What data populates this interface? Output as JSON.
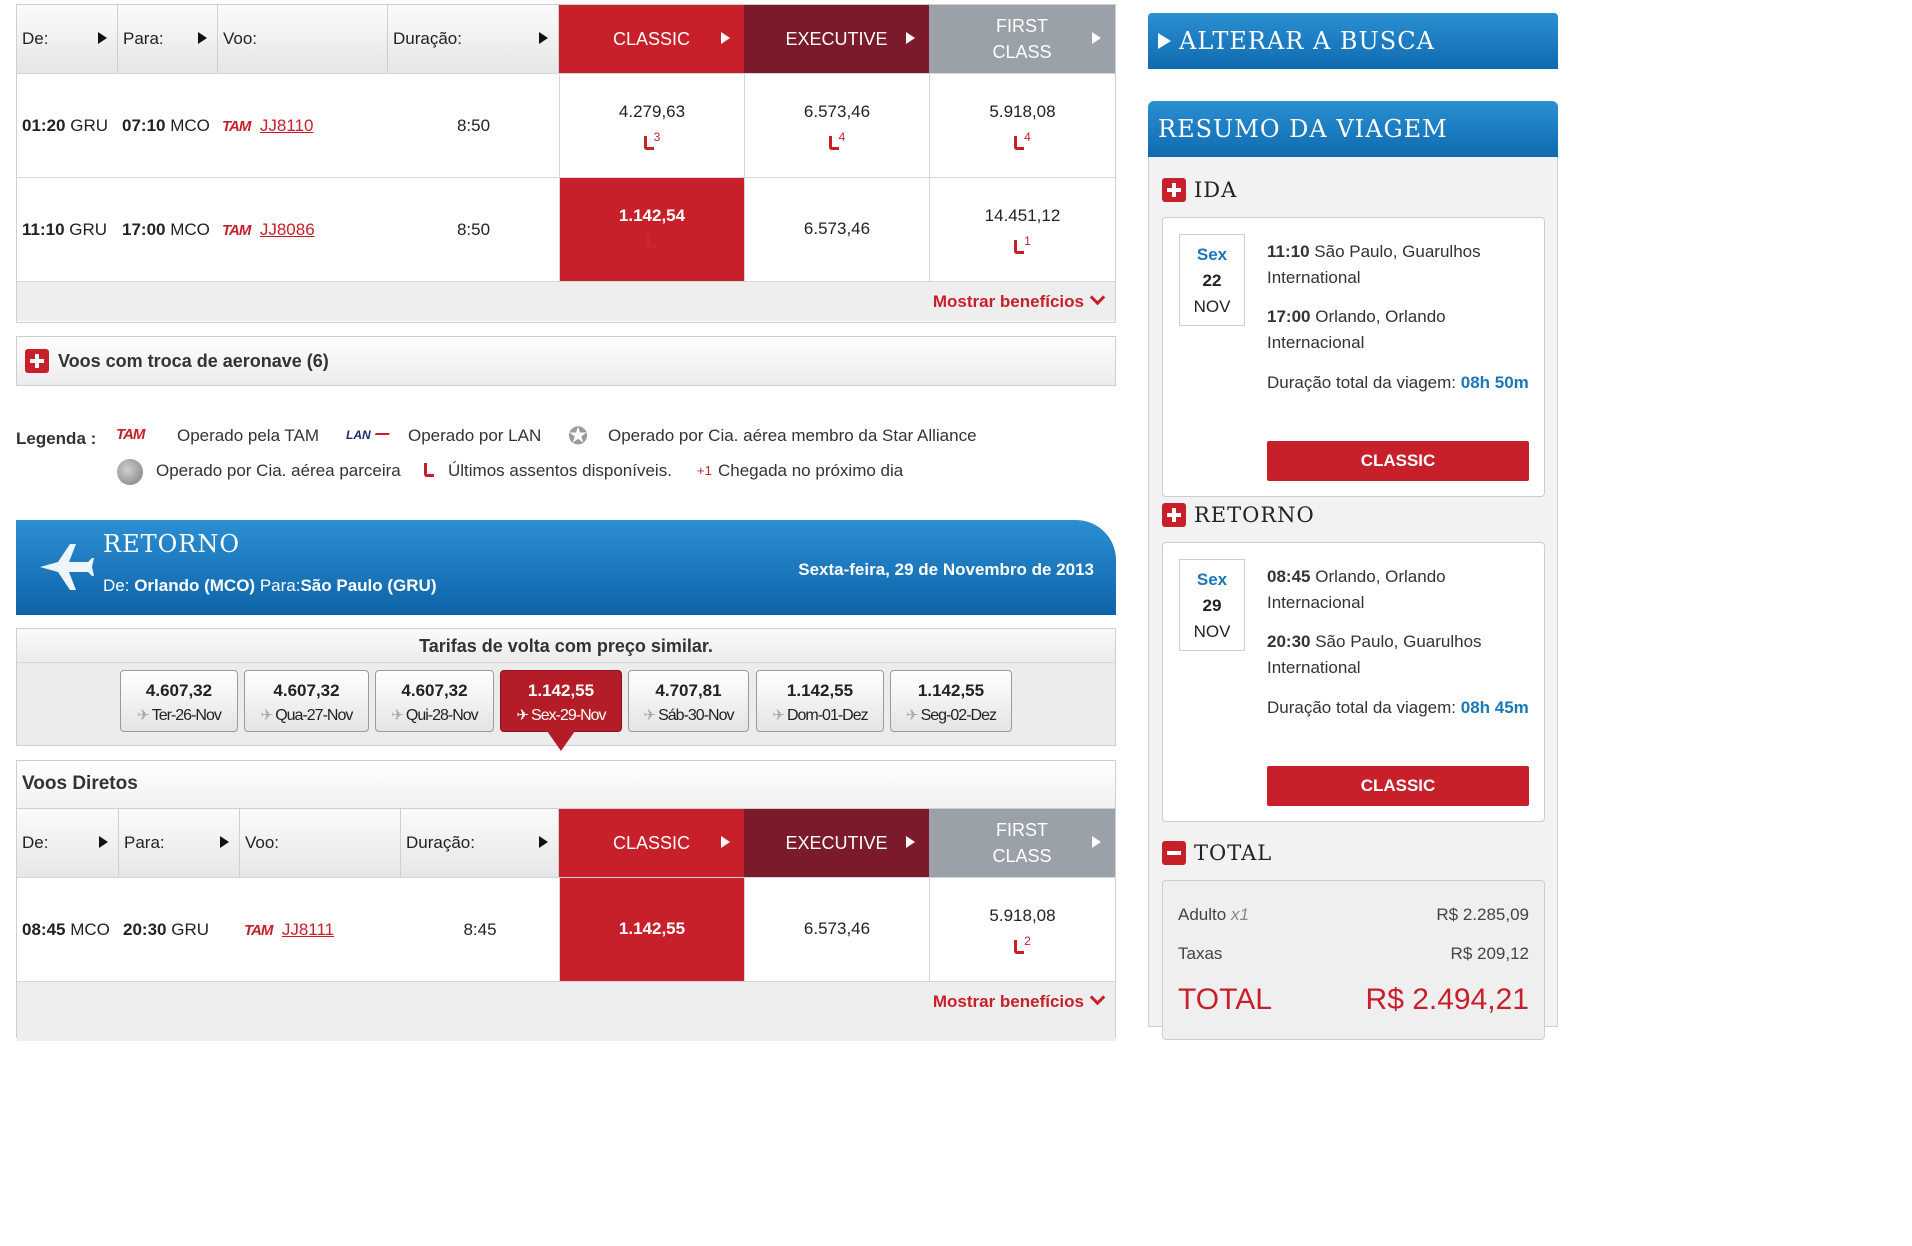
{
  "table_outbound": {
    "headers": {
      "from": "De:",
      "to": "Para:",
      "flight": "Voo:",
      "duration": "Duração:"
    },
    "classes": {
      "classic": "CLASSIC",
      "executive": "EXECUTIVE",
      "first_l1": "FIRST",
      "first_l2": "CLASS"
    },
    "rows": [
      {
        "dep_time": "01:20",
        "dep_code": "GRU",
        "arr_time": "07:10",
        "arr_code": "MCO",
        "airline": "TAM",
        "flight": "JJ8110",
        "duration": "8:50",
        "classic": "4.279,63",
        "classic_seats": "3",
        "executive": "6.573,46",
        "executive_seats": "4",
        "first": "5.918,08",
        "first_seats": "4"
      },
      {
        "dep_time": "11:10",
        "dep_code": "GRU",
        "arr_time": "17:00",
        "arr_code": "MCO",
        "airline": "TAM",
        "flight": "JJ8086",
        "duration": "8:50",
        "classic": "1.142,54",
        "executive": "6.573,46",
        "first": "14.451,12",
        "first_seats": "1"
      }
    ],
    "show_benefits": "Mostrar benefícios"
  },
  "connections": {
    "label": "Voos com troca de aeronave (6)"
  },
  "legend": {
    "title": "Legenda :",
    "tam_logo": "TAM",
    "tam": "Operado pela TAM",
    "lan_logo": "LAN",
    "lan": "Operado por LAN",
    "star": "Operado por Cia. aérea membro da Star Alliance",
    "partner": "Operado por Cia. aérea parceira",
    "last_seats": "Últimos assentos disponíveis.",
    "plus_one": "+1",
    "next_day": "Chegada no próximo dia"
  },
  "return_banner": {
    "title": "RETORNO",
    "from_label": "De:",
    "from_value": "Orlando (MCO)",
    "to_label": "Para:",
    "to_value": "São Paulo (GRU)",
    "date": "Sexta-feira, 29 de Novembro de 2013"
  },
  "similar_fares": {
    "title": "Tarifas de volta com preço similar.",
    "dates": [
      {
        "price": "4.607,32",
        "date": "Ter-26-Nov"
      },
      {
        "price": "4.607,32",
        "date": "Qua-27-Nov"
      },
      {
        "price": "4.607,32",
        "date": "Qui-28-Nov"
      },
      {
        "price": "1.142,55",
        "date": "Sex-29-Nov",
        "selected": true
      },
      {
        "price": "4.707,81",
        "date": "Sáb-30-Nov"
      },
      {
        "price": "1.142,55",
        "date": "Dom-01-Dez"
      },
      {
        "price": "1.142,55",
        "date": "Seg-02-Dez"
      }
    ]
  },
  "table_return": {
    "section_title": "Voos Diretos",
    "headers": {
      "from": "De:",
      "to": "Para:",
      "flight": "Voo:",
      "duration": "Duração:"
    },
    "classes": {
      "classic": "CLASSIC",
      "executive": "EXECUTIVE",
      "first_l1": "FIRST",
      "first_l2": "CLASS"
    },
    "row": {
      "dep_time": "08:45",
      "dep_code": "MCO",
      "arr_time": "20:30",
      "arr_code": "GRU",
      "airline": "TAM",
      "flight": "JJ8111",
      "duration": "8:45",
      "classic": "1.142,55",
      "executive": "6.573,46",
      "first": "5.918,08",
      "first_seats": "2"
    },
    "show_benefits": "Mostrar benefícios"
  },
  "sidebar": {
    "change_search": "ALTERAR A BUSCA",
    "summary_title": "RESUMO DA VIAGEM",
    "outbound": {
      "label": "IDA",
      "weekday": "Sex",
      "day": "22",
      "month": "NOV",
      "dep_time": "11:10",
      "dep_place": "São Paulo, Guarulhos International",
      "arr_time": "17:00",
      "arr_place": "Orlando, Orlando Internacional",
      "duration_label": "Duração total da viagem:",
      "duration_value": "08h 50m",
      "fare_class": "CLASSIC"
    },
    "return": {
      "label": "RETORNO",
      "weekday": "Sex",
      "day": "29",
      "month": "NOV",
      "dep_time": "08:45",
      "dep_place": "Orlando, Orlando Internacional",
      "arr_time": "20:30",
      "arr_place": "São Paulo, Guarulhos International",
      "duration_label": "Duração total da viagem:",
      "duration_value": "08h 45m",
      "fare_class": "CLASSIC"
    },
    "total": {
      "label": "TOTAL",
      "adult_label": "Adulto",
      "adult_count": "x1",
      "adult_value": "R$ 2.285,09",
      "taxes_label": "Taxas",
      "taxes_value": "R$ 209,12",
      "total_label": "TOTAL",
      "total_value": "R$ 2.494,21"
    }
  },
  "colors": {
    "brand_red": "#c8202b",
    "executive": "#7a1a2a",
    "first": "#9ba1a8",
    "brand_blue": "#1a78b9"
  }
}
